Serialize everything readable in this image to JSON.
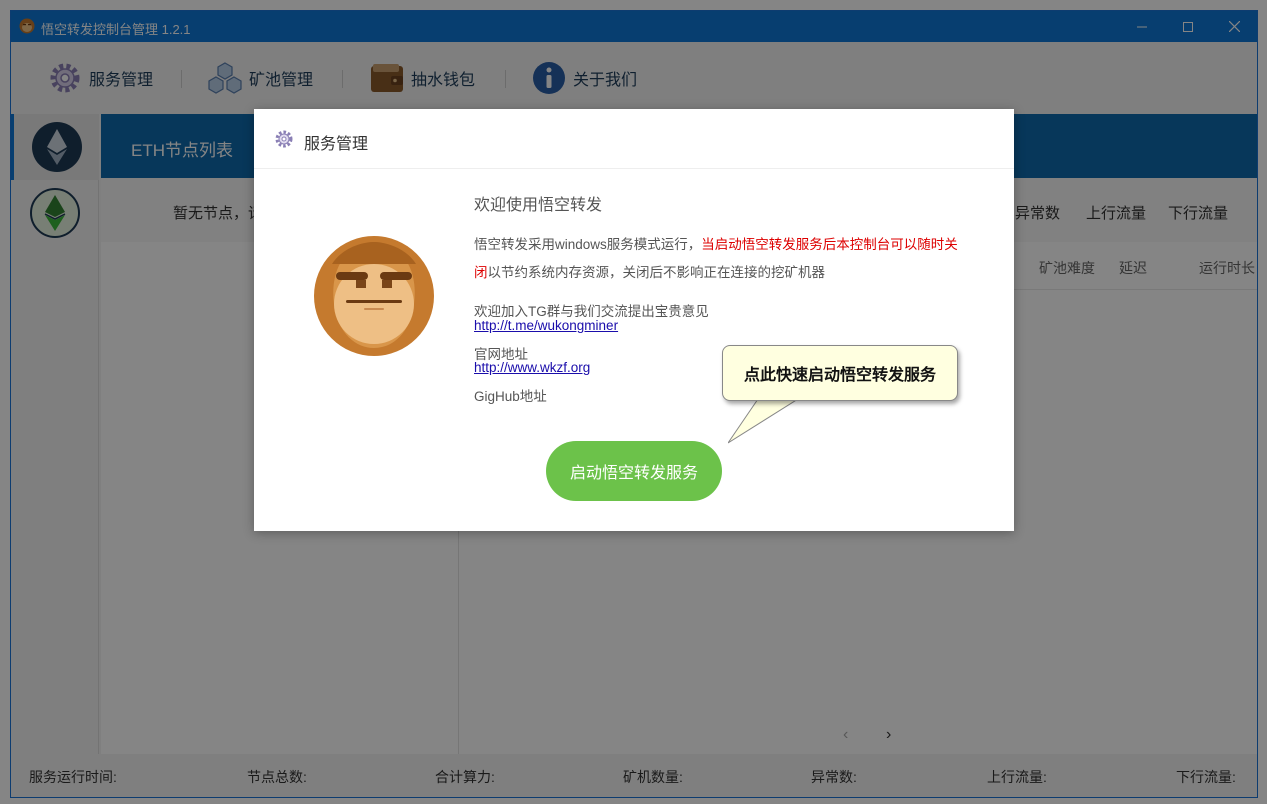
{
  "window": {
    "title": "悟空转发控制台管理 1.2.1",
    "controls": {
      "minimize": "─",
      "maximize": "☐",
      "close": "✕"
    }
  },
  "toolbar": {
    "items": [
      {
        "label": "服务管理",
        "icon": "gear-icon"
      },
      {
        "label": "矿池管理",
        "icon": "cubes-icon"
      },
      {
        "label": "抽水钱包",
        "icon": "wallet-icon"
      },
      {
        "label": "关于我们",
        "icon": "info-icon"
      }
    ]
  },
  "sidebar": {
    "items": [
      {
        "name": "eth",
        "icon": "ethereum-icon",
        "active": true
      },
      {
        "name": "etc",
        "icon": "ethereum-classic-icon",
        "active": false
      }
    ]
  },
  "main": {
    "tab_title": "ETH节点列表",
    "summary_left": "暂无节点，请",
    "summary_cols": [
      "异常数",
      "上行流量",
      "下行流量"
    ],
    "table_cols": [
      "矿池难度",
      "延迟",
      "运行时长"
    ],
    "pager": {
      "prev": "‹",
      "next": "›"
    }
  },
  "statusbar": {
    "items": [
      "服务运行时间:",
      "节点总数:",
      "合计算力:",
      "矿机数量:",
      "异常数:",
      "上行流量:",
      "下行流量:"
    ]
  },
  "dialog": {
    "title": "服务管理",
    "welcome": "欢迎使用悟空转发",
    "desc_part1": "悟空转发采用windows服务模式运行，",
    "desc_red": "当启动悟空转发服务后本控制台可以随时关闭",
    "desc_part2": "以节约系统内存资源，关闭后不影响正在连接的挖矿机器",
    "tg_text": "欢迎加入TG群与我们交流提出宝贵意见",
    "tg_link": "http://t.me/wukongminer",
    "site_label": "官网地址",
    "site_link": "http://www.wkzf.org",
    "gighub_label": "GigHub地址",
    "start_button": "启动悟空转发服务"
  },
  "callout": {
    "text": "点此快速启动悟空转发服务"
  },
  "colors": {
    "titlebar": "#0f78d7",
    "header_bar": "#0f6aac",
    "start_button": "#6cc24a",
    "red_text": "#dd0000",
    "callout_bg": "#ffffe0"
  }
}
